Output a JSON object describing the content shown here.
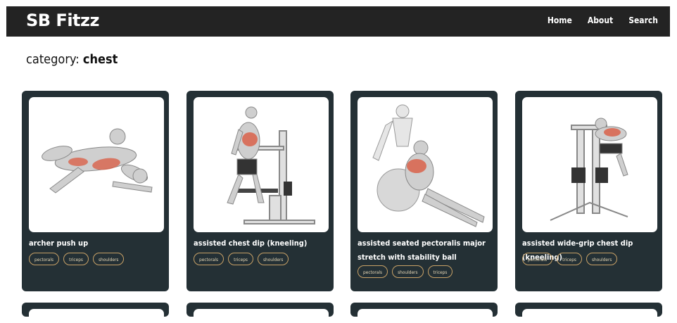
{
  "brand": "SB Fitzz",
  "nav": [
    "Home",
    "About",
    "Search"
  ],
  "category": {
    "prefix": "category:",
    "name": "chest"
  },
  "cards": [
    {
      "name": "archer push up",
      "tags": [
        "pectorals",
        "triceps",
        "shoulders"
      ]
    },
    {
      "name": "assisted chest dip (kneeling)",
      "tags": [
        "pectorals",
        "triceps",
        "shoulders"
      ]
    },
    {
      "name": "assisted seated pectoralis major stretch with stability ball",
      "tags": [
        "pectorals",
        "shoulders",
        "triceps"
      ]
    },
    {
      "name": "assisted wide-grip chest dip (kneeling)",
      "tags": [
        "pectorals",
        "triceps",
        "shoulders"
      ]
    }
  ],
  "colors": {
    "navbar": "#232323",
    "card": "#243035",
    "tag_border": "#c9a267",
    "muscle_highlight": "#d9624a"
  }
}
